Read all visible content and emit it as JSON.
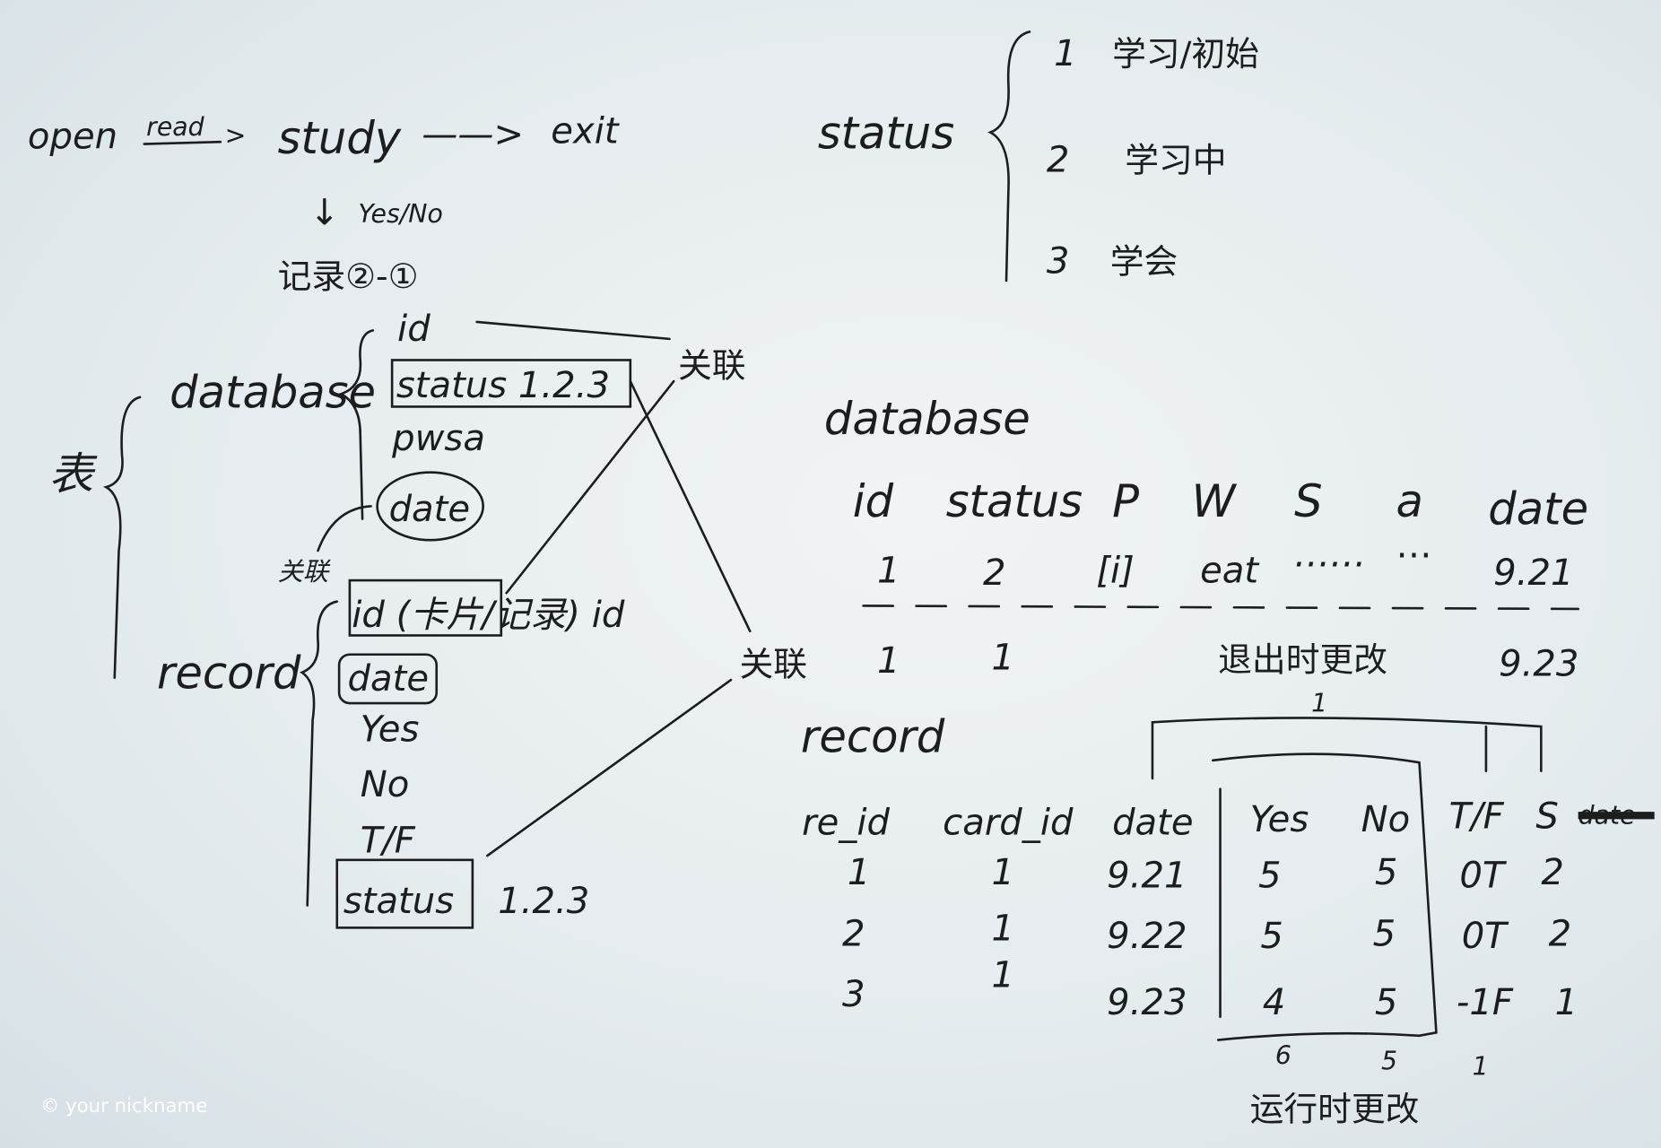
{
  "flow": {
    "open": "open",
    "read": "read",
    "arrow": ">",
    "study": "study",
    "exit_arrow": "——>",
    "exit": "exit",
    "down": "↓",
    "yes_no": "Yes/No",
    "record_note": "记录②-①"
  },
  "left_schema": {
    "table_label": "表",
    "database": "database",
    "database_fields": [
      "id",
      "status 1.2.3",
      "pwsa",
      "date"
    ],
    "relate_top": "关联",
    "relate_small": "关联",
    "record": "record",
    "record_fields": [
      "id (卡片/记录) id",
      "date",
      "Yes",
      "No",
      "T/F",
      "status"
    ],
    "status_values": "1.2.3",
    "relate_mid": "关联"
  },
  "status_legend": {
    "title": "status",
    "items": [
      {
        "num": "1",
        "label": "学习/初始"
      },
      {
        "num": "2",
        "label": "学习中"
      },
      {
        "num": "3",
        "label": "学会"
      }
    ]
  },
  "database_table": {
    "title": "database",
    "headers": [
      "id",
      "status",
      "P",
      "W",
      "S",
      "a",
      "date"
    ],
    "row1": {
      "id": "1",
      "status": "2",
      "p": "[i]",
      "w": "eat",
      "s": "……",
      "a": "⋯",
      "date": "9.21"
    },
    "row2": {
      "id": "1",
      "status": "1",
      "note": "退出时更改",
      "date": "9.23"
    }
  },
  "record_table": {
    "title": "record",
    "headers": [
      "re_id",
      "card_id",
      "date",
      "Yes",
      "No",
      "T/F",
      "S",
      "date"
    ],
    "rows": [
      [
        "1",
        "1",
        "9.21",
        "5",
        "5",
        "0T",
        "2"
      ],
      [
        "2",
        "1",
        "9.22",
        "5",
        "5",
        "0T",
        "2"
      ],
      [
        "3",
        "1",
        "9.23",
        "4",
        "5",
        "-1F",
        "1"
      ]
    ],
    "top_marker": "1",
    "totals": {
      "yes": "6",
      "no": "5",
      "tf": "1"
    },
    "runtime_note": "运行时更改"
  },
  "watermark": "© your nickname"
}
